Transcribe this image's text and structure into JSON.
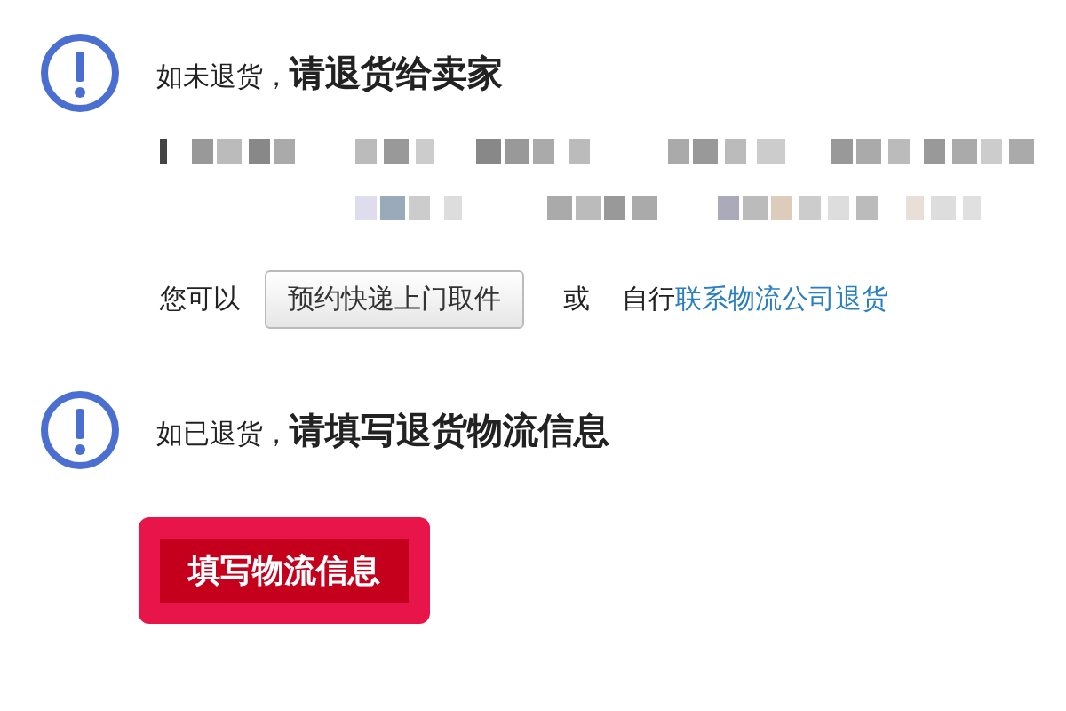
{
  "sections": [
    {
      "kind": "return",
      "prefix": "如未退货，",
      "title": "请退货给卖家"
    },
    {
      "kind": "logistics",
      "prefix": "如已退货，",
      "title": "请填写退货物流信息"
    }
  ],
  "pickup": {
    "lead": "您可以",
    "button": "预约快递上门取件",
    "or": "或",
    "self": "自行",
    "link": "联系物流公司退货"
  },
  "fill_button": "填写物流信息"
}
